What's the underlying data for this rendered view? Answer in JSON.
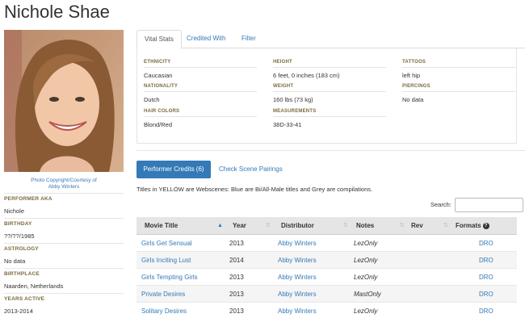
{
  "performer": {
    "name": "Nichole Shae",
    "photo_credit_line1": "Photo Copyright/Courtesy of",
    "photo_credit_line2": "Abby Winters"
  },
  "bio": [
    {
      "label": "Performer AKA",
      "value": "Nichole"
    },
    {
      "label": "Birthday",
      "value": "??/??/1985"
    },
    {
      "label": "Astrology",
      "value": "No data"
    },
    {
      "label": "Birthplace",
      "value": "Naarden, Netherlands"
    },
    {
      "label": "Years Active",
      "value": "2013-2014"
    }
  ],
  "tabs": [
    {
      "label": "Vital Stats",
      "active": true
    },
    {
      "label": "Credited With",
      "active": false
    },
    {
      "label": "Filter",
      "active": false
    }
  ],
  "stats": {
    "ethnicity": {
      "label": "Ethnicity",
      "value": "Caucasian"
    },
    "nationality": {
      "label": "Nationality",
      "value": "Dutch"
    },
    "hair_colors": {
      "label": "Hair Colors",
      "value": "Blond/Red"
    },
    "height": {
      "label": "Height",
      "value": "6 feet, 0 inches (183 cm)"
    },
    "weight": {
      "label": "Weight",
      "value": "160 lbs (73 kg)"
    },
    "measurements": {
      "label": "Measurements",
      "value": "38D-33-41"
    },
    "tattoos": {
      "label": "Tattoos",
      "value": "left hip"
    },
    "piercings": {
      "label": "Piercings",
      "value": "No data"
    }
  },
  "credits": {
    "performer_credits_button": "Performer Credits (6)",
    "check_pairings_link": "Check Scene Pairings",
    "legend_note": "Titles in YELLOW are Webscenes: Blue are Bi/All-Male titles and Grey are compilations.",
    "search_label": "Search:",
    "search_value": "",
    "columns": [
      "Movie Title",
      "Year",
      "Distributor",
      "Notes",
      "Rev",
      "Formats"
    ],
    "rows": [
      {
        "title": "Girls Get Sensual",
        "year": "2013",
        "distributor": "Abby Winters",
        "notes": "LezOnly",
        "rev": "",
        "formats": "DRO"
      },
      {
        "title": "Girls Inciting Lust",
        "year": "2014",
        "distributor": "Abby Winters",
        "notes": "LezOnly",
        "rev": "",
        "formats": "DRO"
      },
      {
        "title": "Girls Tempting Girls",
        "year": "2013",
        "distributor": "Abby Winters",
        "notes": "LezOnly",
        "rev": "",
        "formats": "DRO"
      },
      {
        "title": "Private Desires",
        "year": "2013",
        "distributor": "Abby Winters",
        "notes": "MastOnly",
        "rev": "",
        "formats": "DRO"
      },
      {
        "title": "Solitary Desires",
        "year": "2013",
        "distributor": "Abby Winters",
        "notes": "LezOnly",
        "rev": "",
        "formats": "DRO"
      }
    ]
  },
  "colors": {
    "link": "#337ab7",
    "label_gold": "#7a6a3e",
    "header_bg": "#e5e5e5",
    "button_bg": "#337ab7"
  },
  "icons": {
    "sort_asc": "sort-up-icon",
    "sort_both": "sort-icon",
    "help": "question-circle-icon"
  }
}
